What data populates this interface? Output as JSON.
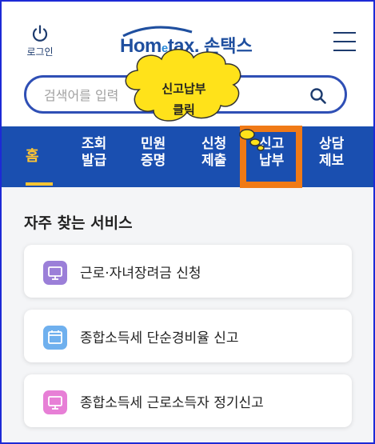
{
  "header": {
    "login_label": "로그인",
    "logo_main_pre": "Hom",
    "logo_main_e": "e",
    "logo_main_post": "tax.",
    "logo_sub": "손택스"
  },
  "search": {
    "placeholder": "검색어를 입력"
  },
  "nav": {
    "items": [
      {
        "line1": "홈",
        "line2": ""
      },
      {
        "line1": "조회",
        "line2": "발급"
      },
      {
        "line1": "민원",
        "line2": "증명"
      },
      {
        "line1": "신청",
        "line2": "제출"
      },
      {
        "line1": "신고",
        "line2": "납부"
      },
      {
        "line1": "상담",
        "line2": "제보"
      }
    ]
  },
  "callout": {
    "line1": "신고납부",
    "line2": "클릭"
  },
  "services": {
    "title": "자주 찾는 서비스",
    "items": [
      {
        "label": "근로·자녀장려금 신청",
        "icon": "monitor-icon",
        "color": "#9b7fd8"
      },
      {
        "label": "종합소득세 단순경비율 신고",
        "icon": "calendar-icon",
        "color": "#6fb0ee"
      },
      {
        "label": "종합소득세 근로소득자 정기신고",
        "icon": "monitor-icon",
        "color": "#e77fd6"
      }
    ]
  },
  "colors": {
    "nav_bg": "#1a4fb0",
    "active": "#ffc533",
    "highlight": "#f07a16",
    "frame": "#1d2ad6"
  }
}
